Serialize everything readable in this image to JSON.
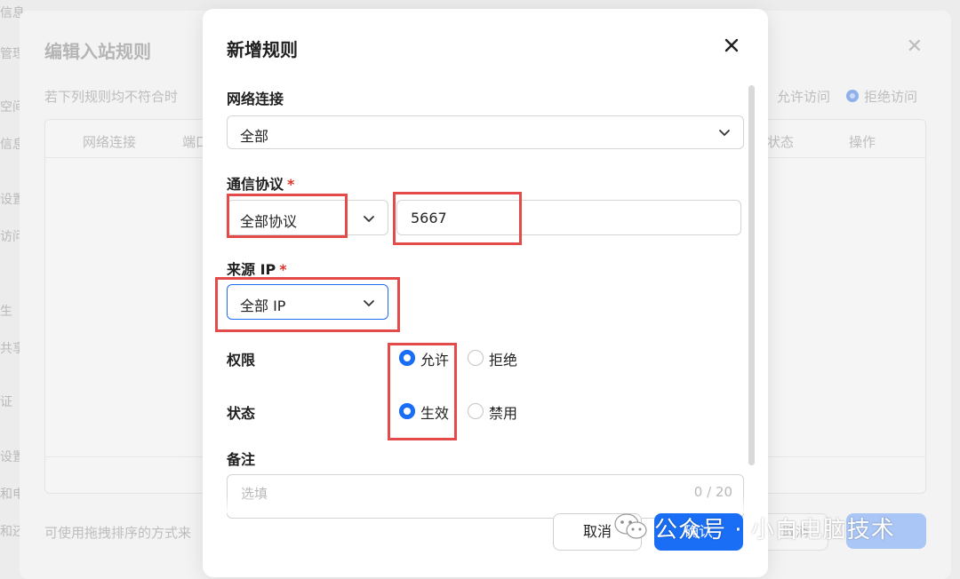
{
  "background": {
    "sidebar_fragments": [
      "信息",
      "管理",
      "空间",
      "信息",
      "设置",
      "访问",
      "生",
      "共享",
      "证",
      "设置",
      "和电",
      "和还"
    ],
    "title": "编辑入站规则",
    "hint": "若下列规则均不符合时",
    "allow_label": "允许访问",
    "deny_label": "拒绝访问",
    "columns": [
      "网络连接",
      "端口",
      "状态",
      "操作"
    ],
    "drag_hint": "可使用拖拽排序的方式来",
    "cancel_label": "取消"
  },
  "modal": {
    "title": "新增规则",
    "network": {
      "label": "网络连接",
      "value": "全部"
    },
    "protocol": {
      "label": "通信协议",
      "required_mark": "*",
      "value": "全部协议",
      "port_value": "5667"
    },
    "source_ip": {
      "label": "来源 IP",
      "required_mark": "*",
      "value": "全部 IP"
    },
    "permission": {
      "label": "权限",
      "options": [
        "允许",
        "拒绝"
      ],
      "selected": "允许"
    },
    "status": {
      "label": "状态",
      "options": [
        "生效",
        "禁用"
      ],
      "selected": "生效"
    },
    "remark": {
      "label": "备注",
      "placeholder": "选填",
      "counter": "0 / 20"
    },
    "buttons": {
      "cancel": "取消",
      "confirm": "确认"
    }
  },
  "watermark": {
    "text": "公众号 · 小白电脑技术"
  },
  "colors": {
    "accent": "#1a6ef5",
    "highlight": "#e34b4b",
    "required": "#e0352b"
  }
}
